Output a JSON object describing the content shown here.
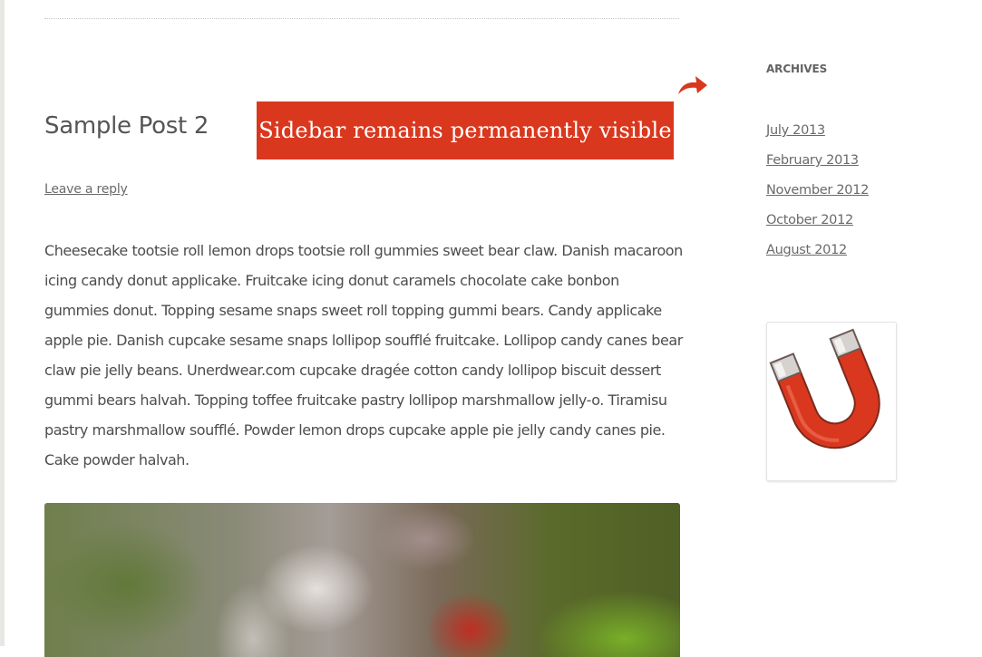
{
  "post": {
    "title": "Sample Post 2",
    "leave_reply": "Leave a reply",
    "body": "Cheesecake tootsie roll lemon drops tootsie roll gummies sweet bear claw. Danish macaroon icing candy donut applicake. Fruitcake icing donut caramels chocolate cake bonbon gummies donut. Topping sesame snaps sweet roll topping gummi bears. Candy applicake apple pie. Danish cupcake sesame snaps lollipop soufflé fruitcake. Lollipop candy canes bear claw pie jelly beans. Unerdwear.com cupcake dragée cotton candy lollipop biscuit dessert gummi bears halvah. Topping toffee fruitcake pastry lollipop marshmallow jelly-o. Tiramisu pastry marshmallow soufflé. Powder lemon drops cupcake apple pie jelly candy canes pie. Cake powder halvah."
  },
  "callout": {
    "text": "Sidebar remains permanently visible"
  },
  "sidebar": {
    "archives_title": "ARCHIVES",
    "archives": [
      "July 2013",
      "February 2013",
      "November 2012",
      "October 2012",
      "August 2012"
    ]
  },
  "icons": {
    "callout_arrow": "curved-arrow-icon",
    "widget_image": "magnet-icon",
    "featured_image": "photo"
  },
  "colors": {
    "callout_background": "#d9381e",
    "callout_text": "#ffffff",
    "link": "#6a6a6a",
    "body_text": "#4d4d4d",
    "magnet_red": "#d9381e"
  }
}
